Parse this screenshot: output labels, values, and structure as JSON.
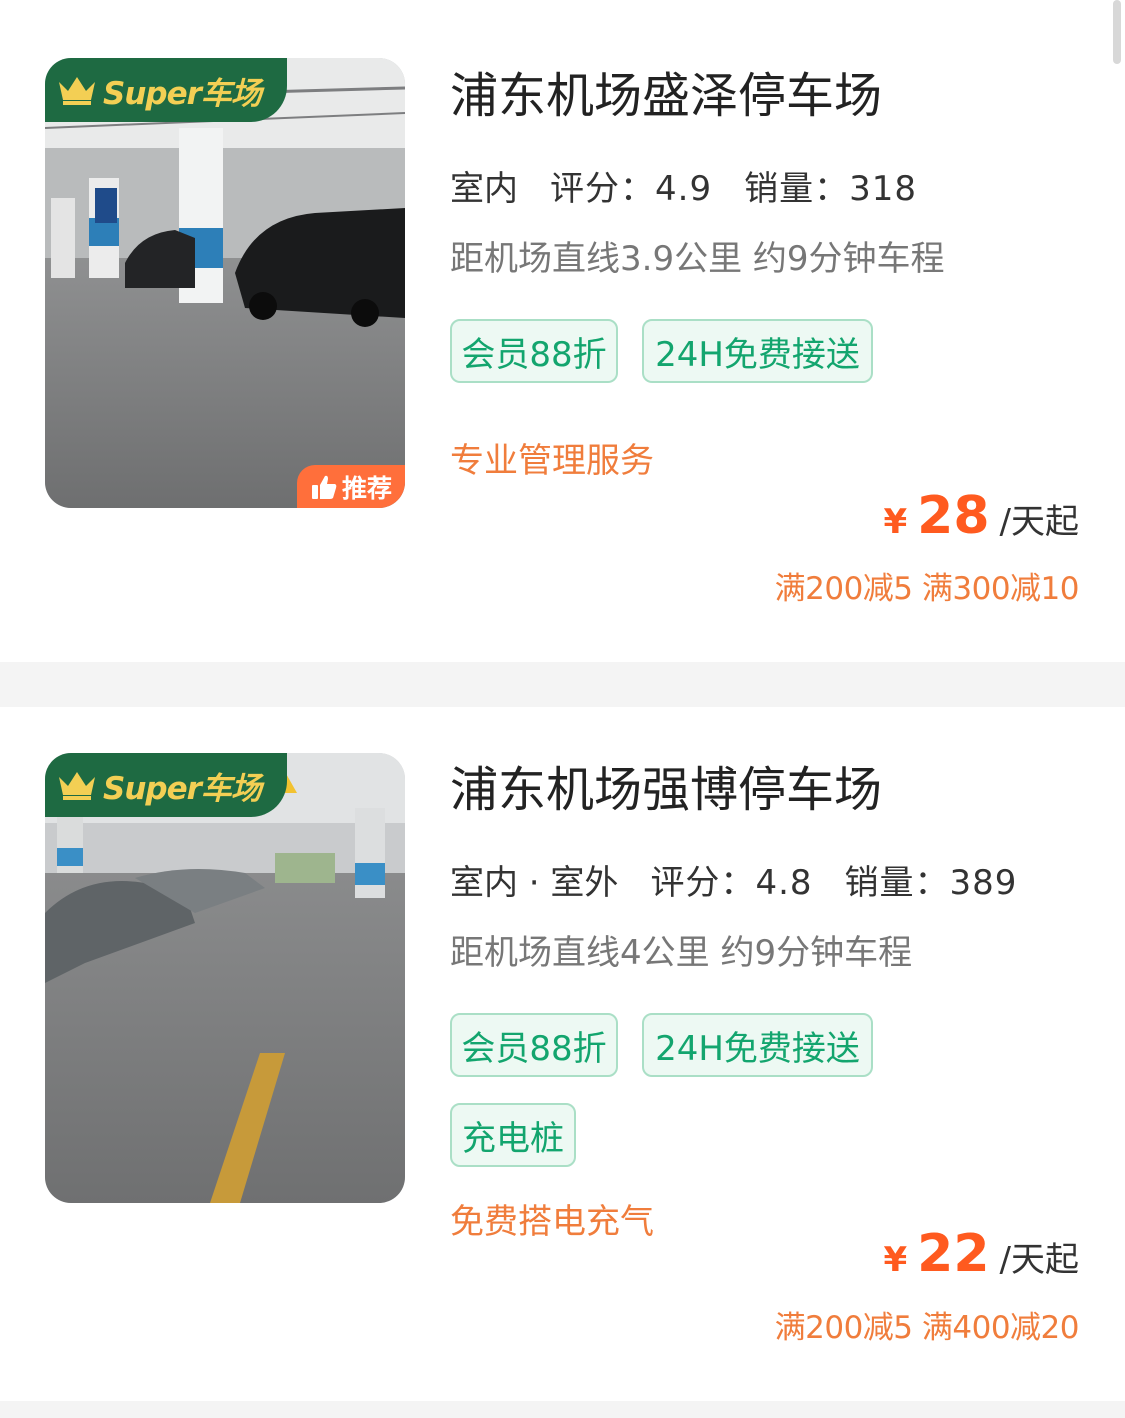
{
  "lots": [
    {
      "super_badge": "Super车场",
      "recommend_badge": "推荐",
      "name": "浦东机场盛泽停车场",
      "environment": "室内",
      "rating_label": "评分：",
      "rating": "4.9",
      "sales_label": "销量：",
      "sales": "318",
      "distance": "距机场直线3.9公里 约9分钟车程",
      "tags": [
        "会员88折",
        "24H免费接送"
      ],
      "feature": "专业管理服务",
      "currency": "¥",
      "price": "28",
      "price_unit": "/天起",
      "discount": "满200减5 满300减10"
    },
    {
      "super_badge": "Super车场",
      "name": "浦东机场强博停车场",
      "environment": "室内 · 室外",
      "rating_label": "评分：",
      "rating": "4.8",
      "sales_label": "销量：",
      "sales": "389",
      "distance": "距机场直线4公里 约9分钟车程",
      "tags": [
        "会员88折",
        "24H免费接送",
        "充电桩"
      ],
      "feature": "免费搭电充气",
      "currency": "¥",
      "price": "22",
      "price_unit": "/天起",
      "discount": "满200减5 满400减20"
    }
  ],
  "colors": {
    "brand_green": "#1e6a42",
    "badge_gold": "#f3cf54",
    "tag_green": "#13a56e",
    "price_orange": "#ff5a1f",
    "feature_orange": "#f07d3c",
    "recommend_orange": "#ff6f3b"
  }
}
